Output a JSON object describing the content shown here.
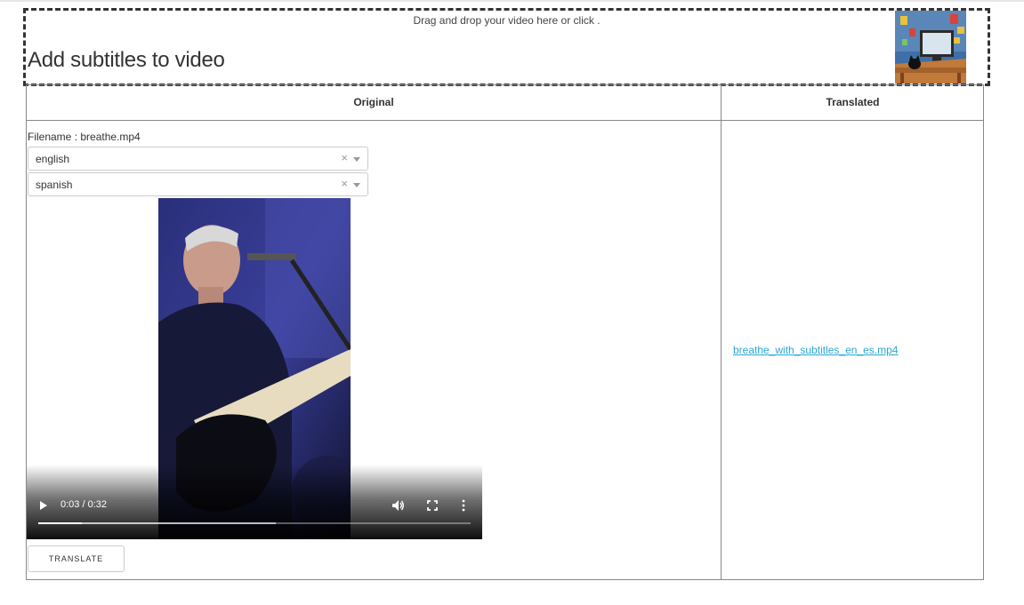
{
  "dropzone": {
    "hint": "Drag and drop your video here or click .",
    "title": "Add subtitles to video"
  },
  "table": {
    "col_original": "Original",
    "col_translated": "Translated"
  },
  "original": {
    "filename_label": "Filename : breathe.mp4",
    "source_language": "english",
    "target_language": "spanish",
    "clear_glyph": "×",
    "video": {
      "time": "0:03 / 0:32",
      "progress": 0.1,
      "buffered": 0.55
    },
    "translate_label": "TRANSLATE"
  },
  "translated": {
    "link_text": "breathe_with_subtitles_en_es.mp4"
  },
  "colors": {
    "link": "#2aa7d4",
    "border": "#888888"
  }
}
